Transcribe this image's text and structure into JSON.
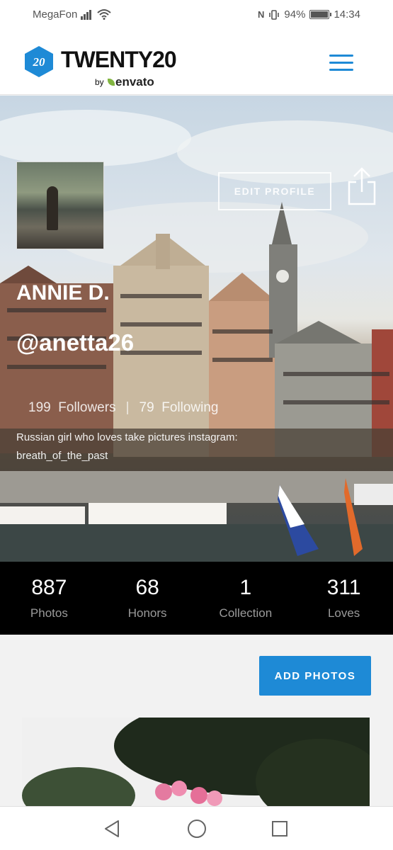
{
  "status_bar": {
    "carrier": "MegaFon",
    "nfc": "N",
    "battery_percent": "94%",
    "time": "14:34"
  },
  "header": {
    "logo_mark": "20",
    "logo_text": "TWENTY20",
    "by_text": "by",
    "envato_text": "envato",
    "menu_icon": "hamburger-icon"
  },
  "profile": {
    "edit_label": "EDIT PROFILE",
    "name": "ANNIE D.",
    "handle": "@anetta26",
    "followers_count": "199",
    "followers_label": "Followers",
    "following_count": "79",
    "following_label": "Following",
    "bio_line1": "Russian girl who loves take pictures instagram:",
    "bio_line2": "breath_of_the_past"
  },
  "stats": [
    {
      "value": "887",
      "label": "Photos"
    },
    {
      "value": "68",
      "label": "Honors"
    },
    {
      "value": "1",
      "label": "Collection"
    },
    {
      "value": "311",
      "label": "Loves"
    }
  ],
  "actions": {
    "add_photos_label": "ADD PHOTOS"
  },
  "colors": {
    "accent": "#1e8ad6",
    "logo_blue": "#1e8ad6",
    "envato_green": "#82b541",
    "stats_bg": "#000000"
  }
}
